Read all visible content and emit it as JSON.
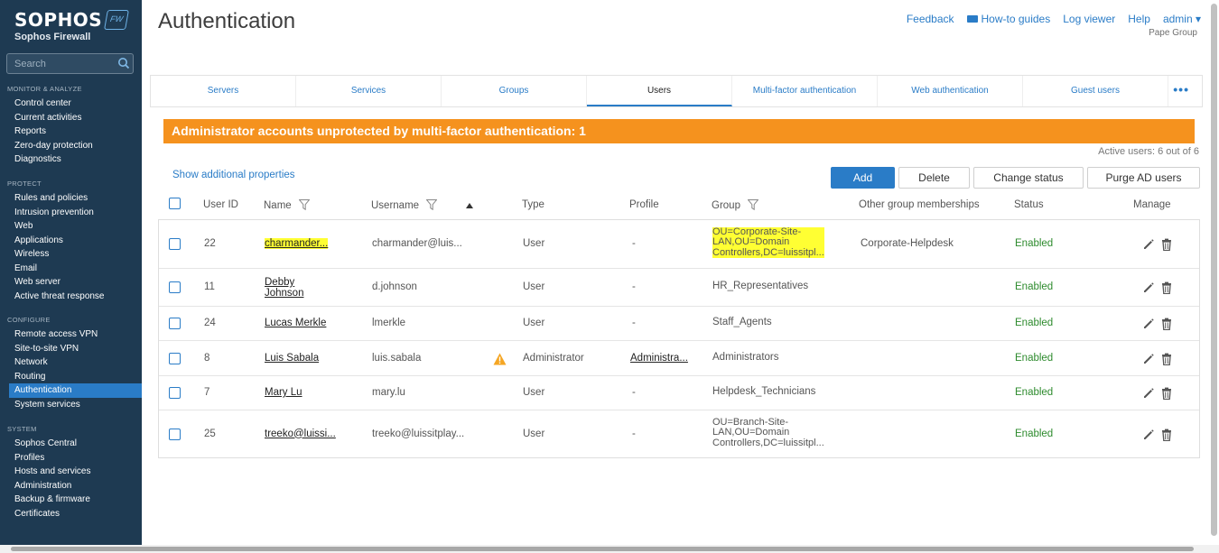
{
  "brand": {
    "logo": "SOPHOS",
    "badge": "FW",
    "subtitle": "Sophos Firewall"
  },
  "search": {
    "placeholder": "Search"
  },
  "sidebar": {
    "sections": [
      {
        "heading": "MONITOR & ANALYZE",
        "items": [
          "Control center",
          "Current activities",
          "Reports",
          "Zero-day protection",
          "Diagnostics"
        ]
      },
      {
        "heading": "PROTECT",
        "items": [
          "Rules and policies",
          "Intrusion prevention",
          "Web",
          "Applications",
          "Wireless",
          "Email",
          "Web server",
          "Active threat response"
        ]
      },
      {
        "heading": "CONFIGURE",
        "items": [
          "Remote access VPN",
          "Site-to-site VPN",
          "Network",
          "Routing",
          "Authentication",
          "System services"
        ]
      },
      {
        "heading": "SYSTEM",
        "items": [
          "Sophos Central",
          "Profiles",
          "Hosts and services",
          "Administration",
          "Backup & firmware",
          "Certificates"
        ]
      }
    ],
    "active_item": "Authentication"
  },
  "header": {
    "title": "Authentication",
    "links": [
      "Feedback",
      "How-to guides",
      "Log viewer",
      "Help",
      "admin ▾"
    ],
    "org": "Pape Group"
  },
  "tabs": [
    "Servers",
    "Services",
    "Groups",
    "Users",
    "Multi-factor authentication",
    "Web authentication",
    "Guest users",
    "•••"
  ],
  "active_tab": "Users",
  "banner": "Administrator accounts unprotected by multi-factor authentication: 1",
  "active_users": "Active users: 6 out of 6",
  "show_props": "Show additional properties",
  "buttons": {
    "add": "Add",
    "delete": "Delete",
    "change_status": "Change status",
    "purge": "Purge AD users"
  },
  "columns": {
    "user_id": "User ID",
    "name": "Name",
    "username": "Username",
    "type": "Type",
    "profile": "Profile",
    "group": "Group",
    "other": "Other group memberships",
    "status": "Status",
    "manage": "Manage"
  },
  "rows": [
    {
      "id": "22",
      "name": "charmander...",
      "username": "charmander@luis...",
      "type": "User",
      "profile": "-",
      "group": "OU=Corporate-Site-\nLAN,OU=Domain\nControllers,DC=luissitpl...",
      "other": "Corporate-Helpdesk",
      "status": "Enabled"
    },
    {
      "id": "11",
      "name": "Debby\nJohnson",
      "username": "d.johnson",
      "type": "User",
      "profile": "-",
      "group": "HR_Representatives",
      "other": "",
      "status": "Enabled"
    },
    {
      "id": "24",
      "name": "Lucas Merkle",
      "username": "lmerkle",
      "type": "User",
      "profile": "-",
      "group": "Staff_Agents",
      "other": "",
      "status": "Enabled"
    },
    {
      "id": "8",
      "name": "Luis Sabala",
      "username": "luis.sabala",
      "type": "Administrator",
      "profile": "Administra...",
      "group": "Administrators",
      "other": "",
      "status": "Enabled"
    },
    {
      "id": "7",
      "name": "Mary Lu",
      "username": "mary.lu",
      "type": "User",
      "profile": "-",
      "group": "Helpdesk_Technicians",
      "other": "",
      "status": "Enabled"
    },
    {
      "id": "25",
      "name": "treeko@luissi...",
      "username": "treeko@luissitplay...",
      "type": "User",
      "profile": "-",
      "group": "OU=Branch-Site-\nLAN,OU=Domain\nControllers,DC=luissitpl...",
      "other": "",
      "status": "Enabled"
    }
  ],
  "colors": {
    "sidebar": "#1e3a52",
    "accent": "#2a7cc7",
    "banner": "#f5921e",
    "enabled": "#2e8b2e",
    "highlight": "#ffff33"
  }
}
